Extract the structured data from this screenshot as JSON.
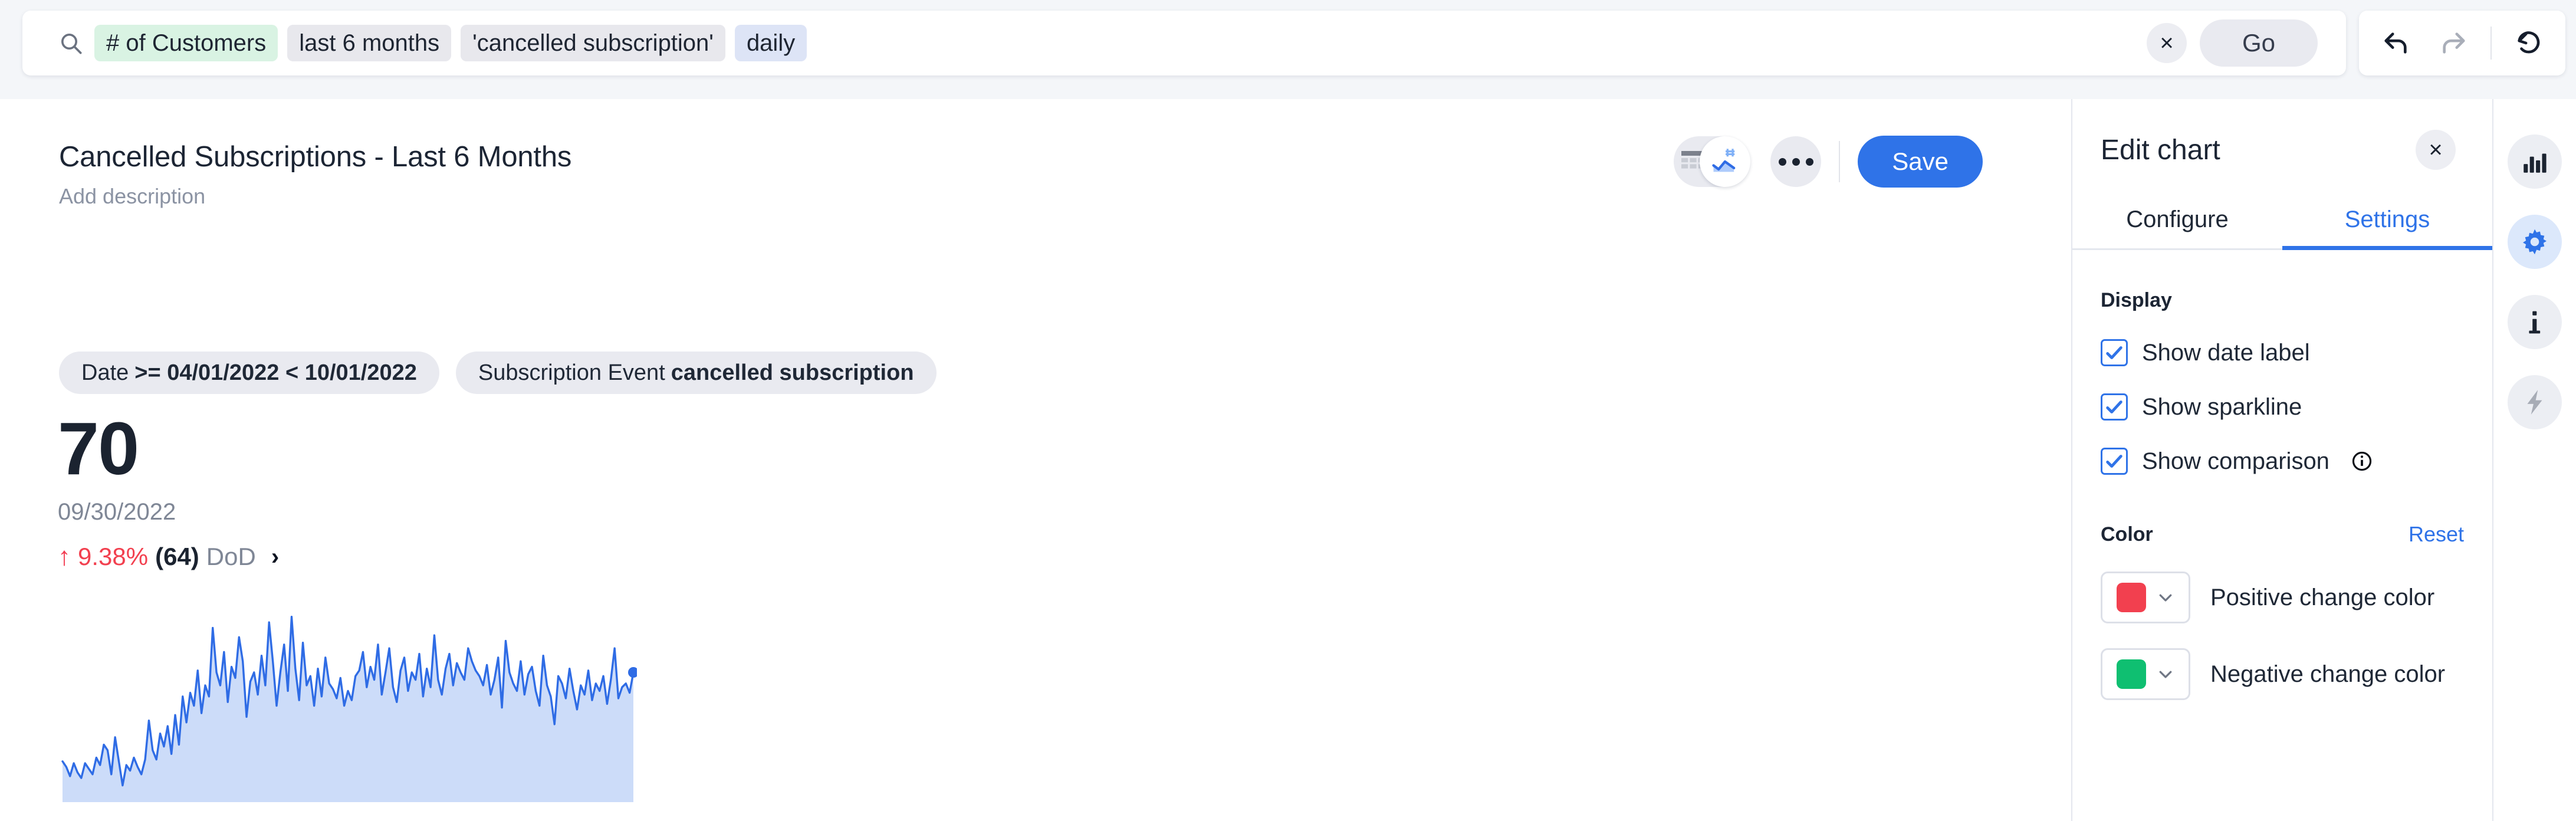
{
  "search": {
    "icon": "search-icon",
    "chips": [
      {
        "label": "# of Customers",
        "kind": "measure"
      },
      {
        "label": "last 6 months",
        "kind": "time"
      },
      {
        "label": "'cancelled subscription'",
        "kind": "filter"
      },
      {
        "label": "daily",
        "kind": "grain"
      }
    ],
    "clear_label": "×",
    "go_label": "Go"
  },
  "history": {
    "undo_icon": "undo-arrow-icon",
    "redo_icon": "redo-arrow-icon",
    "reset_icon": "reset-circular-arrow-icon"
  },
  "chart": {
    "title": "Cancelled Subscriptions - Last 6 Months",
    "description": "Add description",
    "filters": [
      {
        "field": "Date",
        "value": ">= 04/01/2022 < 10/01/2022"
      },
      {
        "field": "Subscription Event",
        "value": "cancelled subscription"
      }
    ],
    "kpi": {
      "value": "70",
      "date": "09/30/2022",
      "arrow": "↑",
      "percent": "9.38%",
      "absolute": "(64)",
      "period": "DoD",
      "chevron": "›"
    }
  },
  "toolbar": {
    "view_table_icon": "table-view-icon",
    "view_chart_icon": "chart-view-icon",
    "more_label": "more-options",
    "save_label": "Save"
  },
  "panel": {
    "title": "Edit chart",
    "close_label": "×",
    "tabs": [
      {
        "label": "Configure",
        "active": false
      },
      {
        "label": "Settings",
        "active": true
      }
    ],
    "display": {
      "section_label": "Display",
      "options": [
        {
          "label": "Show date label",
          "checked": true,
          "info": false
        },
        {
          "label": "Show sparkline",
          "checked": true,
          "info": false
        },
        {
          "label": "Show comparison",
          "checked": true,
          "info": true
        }
      ]
    },
    "color": {
      "section_label": "Color",
      "reset_label": "Reset",
      "rows": [
        {
          "label": "Positive change color",
          "hex": "#f2404f"
        },
        {
          "label": "Negative change color",
          "hex": "#0fbf71"
        }
      ]
    }
  },
  "rail": {
    "items": [
      {
        "icon": "bar-chart-icon",
        "active": false,
        "disabled": false
      },
      {
        "icon": "gear-icon",
        "active": true,
        "disabled": false
      },
      {
        "icon": "info-icon",
        "active": false,
        "disabled": false
      },
      {
        "icon": "lightning-bolt-icon",
        "active": false,
        "disabled": true
      }
    ]
  },
  "chart_data": {
    "type": "area",
    "title": "Cancelled Subscriptions - Last 6 Months",
    "xlabel": "Date",
    "ylabel": "# of Customers",
    "grain": "daily",
    "x_range": [
      "04/01/2022",
      "09/30/2022"
    ],
    "ylim": [
      0,
      105
    ],
    "grid": false,
    "legend": "none",
    "line_color": "#2f6ce5",
    "fill_color": "#ccdcf9",
    "end_marker": {
      "x": "09/30/2022",
      "y": 70
    },
    "annotations": [
      {
        "text": "70",
        "role": "latest-value"
      },
      {
        "text": "9.38% (64) DoD",
        "role": "comparison"
      }
    ],
    "values": [
      22,
      19,
      14,
      21,
      16,
      13,
      21,
      18,
      15,
      24,
      20,
      31,
      28,
      15,
      35,
      22,
      9,
      20,
      17,
      24,
      19,
      15,
      23,
      44,
      28,
      23,
      37,
      30,
      41,
      26,
      47,
      31,
      57,
      43,
      59,
      52,
      71,
      48,
      63,
      57,
      94,
      70,
      63,
      81,
      54,
      73,
      67,
      89,
      76,
      46,
      65,
      70,
      58,
      79,
      63,
      97,
      76,
      52,
      70,
      85,
      60,
      100,
      72,
      55,
      86,
      63,
      68,
      52,
      72,
      57,
      78,
      64,
      61,
      56,
      67,
      52,
      60,
      55,
      68,
      71,
      81,
      62,
      73,
      66,
      85,
      58,
      70,
      83,
      62,
      54,
      71,
      78,
      60,
      70,
      66,
      80,
      57,
      72,
      62,
      90,
      66,
      58,
      72,
      80,
      63,
      75,
      70,
      66,
      83,
      76,
      71,
      68,
      63,
      74,
      58,
      66,
      78,
      51,
      87,
      70,
      64,
      60,
      76,
      58,
      69,
      73,
      60,
      52,
      79,
      63,
      57,
      42,
      68,
      64,
      56,
      72,
      60,
      50,
      63,
      58,
      71,
      55,
      64,
      60,
      68,
      53,
      66,
      83,
      56,
      62,
      64,
      59,
      70
    ]
  }
}
